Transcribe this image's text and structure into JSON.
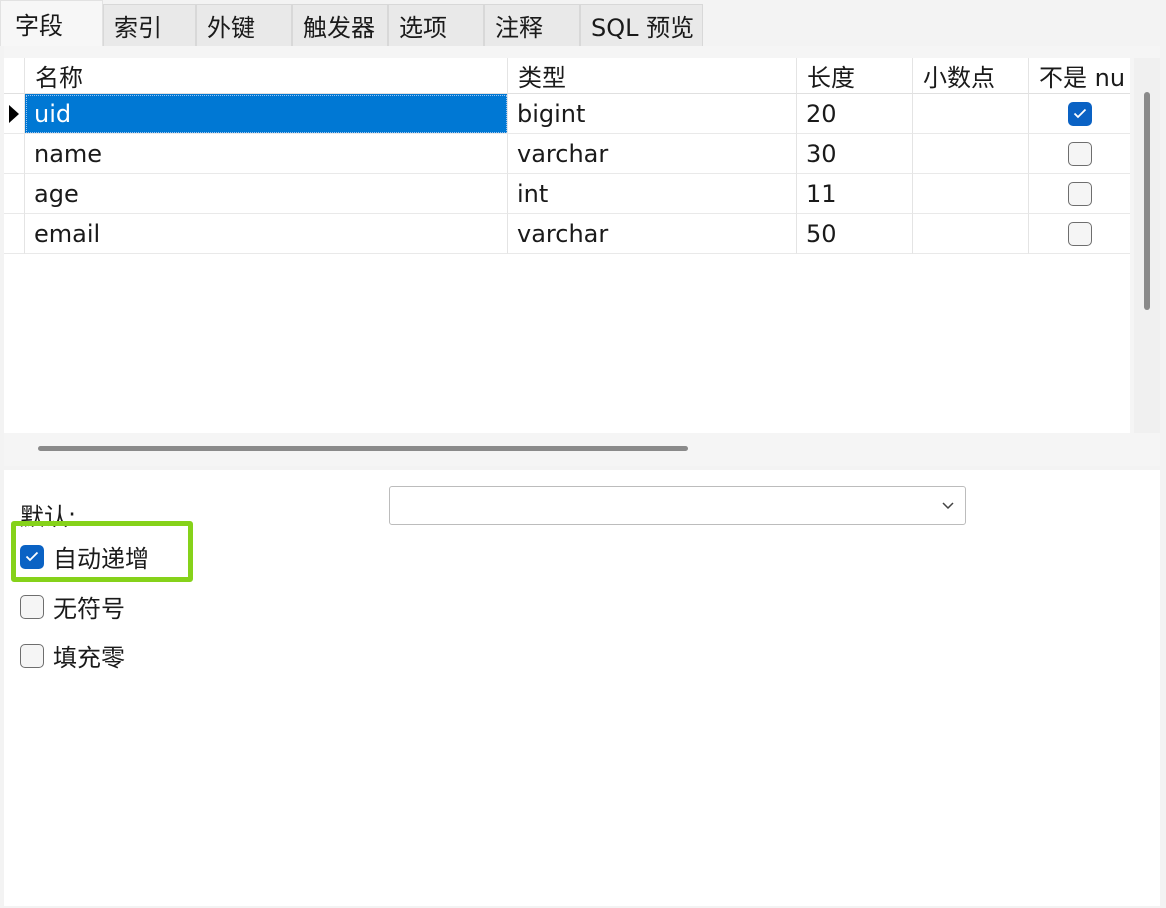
{
  "tabs": [
    {
      "label": "字段",
      "active": true
    },
    {
      "label": "索引",
      "active": false
    },
    {
      "label": "外键",
      "active": false
    },
    {
      "label": "触发器",
      "active": false
    },
    {
      "label": "选项",
      "active": false
    },
    {
      "label": "注释",
      "active": false
    },
    {
      "label": "SQL 预览",
      "active": false
    }
  ],
  "grid": {
    "headers": {
      "name": "名称",
      "type": "类型",
      "length": "长度",
      "decimal": "小数点",
      "not_null": "不是 nu"
    },
    "rows": [
      {
        "name": "uid",
        "type": "bigint",
        "length": "20",
        "decimal": "",
        "not_null": true,
        "selected": true
      },
      {
        "name": "name",
        "type": "varchar",
        "length": "30",
        "decimal": "",
        "not_null": false,
        "selected": false
      },
      {
        "name": "age",
        "type": "int",
        "length": "11",
        "decimal": "",
        "not_null": false,
        "selected": false
      },
      {
        "name": "email",
        "type": "varchar",
        "length": "50",
        "decimal": "",
        "not_null": false,
        "selected": false
      }
    ]
  },
  "props": {
    "default_label": "默认:",
    "default_value": "",
    "auto_increment": {
      "label": "自动递增",
      "checked": true
    },
    "unsigned": {
      "label": "无符号",
      "checked": false
    },
    "zerofill": {
      "label": "填充零",
      "checked": false
    }
  },
  "colors": {
    "accent": "#0078d4",
    "checkbox": "#0a62c4",
    "highlight": "#86d21a"
  }
}
